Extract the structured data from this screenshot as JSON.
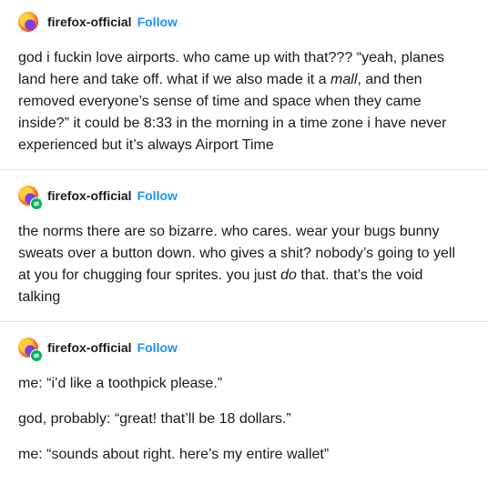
{
  "posts": [
    {
      "username": "firefox-official",
      "follow_label": "Follow",
      "reblog": false,
      "paragraphs": [
        {
          "before": "god i fuckin love airports. who came up with that??? “yeah, planes land here and take off. what if we also made it a ",
          "em": "mall",
          "after": ", and then removed everyone’s sense of time and space when they came inside?” it could be 8:33 in the morning in a time zone i have never experienced but it’s always Airport Time"
        }
      ]
    },
    {
      "username": "firefox-official",
      "follow_label": "Follow",
      "reblog": true,
      "paragraphs": [
        {
          "before": "the norms there are so bizarre. who cares. wear your bugs bunny sweats over a button down. who gives a shit? nobody’s going to yell at you for chugging four sprites. you just ",
          "em": "do",
          "after": " that. that’s the void talking"
        }
      ]
    },
    {
      "username": "firefox-official",
      "follow_label": "Follow",
      "reblog": true,
      "paragraphs": [
        {
          "before": "me: “i’d like a toothpick please.”",
          "em": "",
          "after": ""
        },
        {
          "before": "god, probably: “great! that’ll be 18 dollars.”",
          "em": "",
          "after": ""
        },
        {
          "before": "me: “sounds about right. here’s my entire wallet”",
          "em": "",
          "after": ""
        }
      ]
    }
  ]
}
